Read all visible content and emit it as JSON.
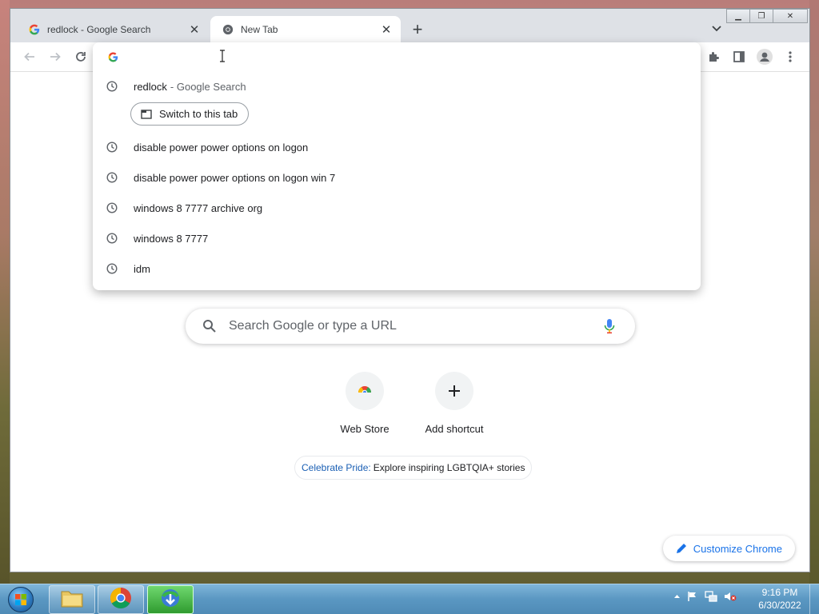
{
  "tabs": [
    {
      "title": "redlock - Google Search",
      "active": false
    },
    {
      "title": "New Tab",
      "active": true
    }
  ],
  "omnibox": {
    "input_value": "",
    "suggestions": [
      {
        "text": "redlock",
        "suffix": "- Google Search",
        "type": "history",
        "switch_label": "Switch to this tab"
      },
      {
        "text": "disable power power options on logon",
        "type": "history"
      },
      {
        "text": "disable power power options on logon win 7",
        "type": "history"
      },
      {
        "text": "windows 8 7777 archive org",
        "type": "history"
      },
      {
        "text": "windows 8 7777",
        "type": "history"
      },
      {
        "text": "idm",
        "type": "history"
      }
    ]
  },
  "ntp": {
    "search_placeholder": "Search Google or type a URL",
    "shortcuts": [
      {
        "label": "Web Store",
        "icon": "chrome-web-store-icon"
      },
      {
        "label": "Add shortcut",
        "icon": "plus-icon"
      }
    ],
    "promo_link": "Celebrate Pride:",
    "promo_text": "Explore inspiring LGBTQIA+ stories",
    "customize_label": "Customize Chrome"
  },
  "taskbar": {
    "items": [
      {
        "name": "windows-explorer",
        "icon": "folder-icon"
      },
      {
        "name": "google-chrome",
        "icon": "chrome-icon"
      },
      {
        "name": "internet-download-manager",
        "icon": "idm-icon",
        "active": true
      }
    ],
    "time": "9:16 PM",
    "date": "6/30/2022"
  },
  "colors": {
    "accent": "#1a73e8",
    "tabstrip": "#dee1e6",
    "taskbar": "#5a97c2"
  }
}
